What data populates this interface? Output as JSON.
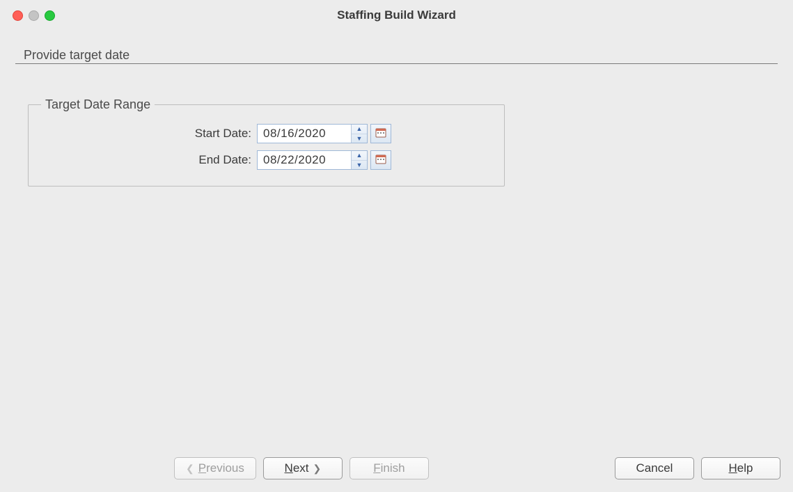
{
  "window": {
    "title": "Staffing Build Wizard"
  },
  "page": {
    "heading": "Provide target date"
  },
  "group": {
    "legend": "Target Date Range"
  },
  "fields": {
    "start": {
      "label": "Start Date:",
      "value": "08/16/2020"
    },
    "end": {
      "label": "End Date:",
      "value": "08/22/2020"
    }
  },
  "buttons": {
    "previous": "Previous",
    "next": "Next",
    "finish": "Finish",
    "cancel": "Cancel",
    "help": "Help"
  }
}
